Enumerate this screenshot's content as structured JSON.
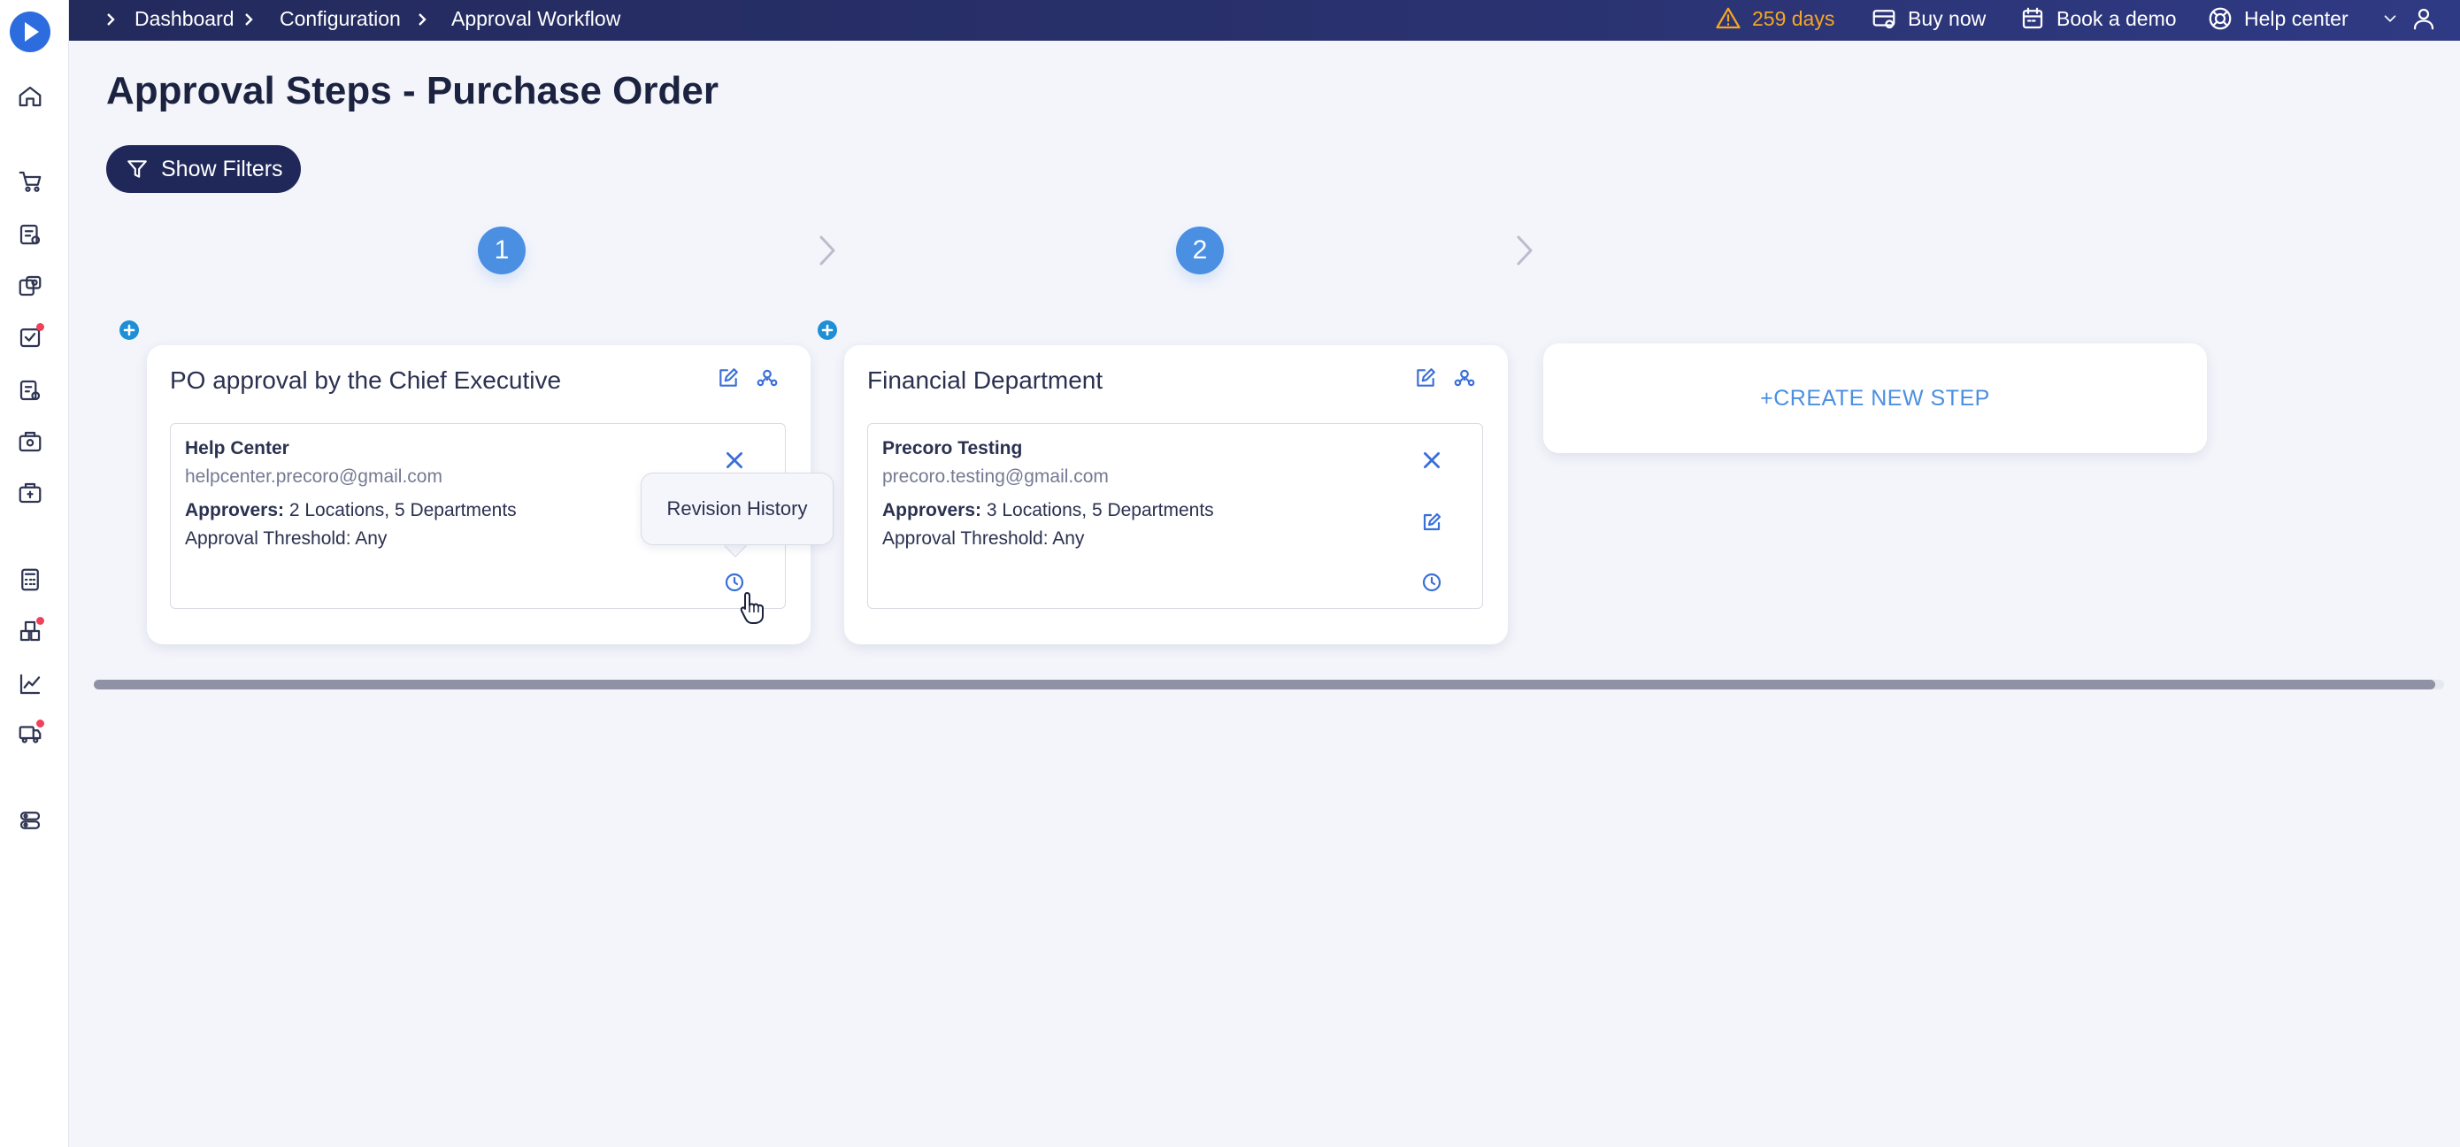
{
  "topbar": {
    "breadcrumbs": [
      "Dashboard",
      "Configuration",
      "Approval Workflow"
    ],
    "trial": "259 days",
    "buy_now": "Buy now",
    "book_demo": "Book a demo",
    "help_center": "Help center"
  },
  "page": {
    "title": "Approval Steps - Purchase Order",
    "filters_label": "Show Filters"
  },
  "steps": [
    {
      "number": "1",
      "title": "PO approval by the Chief Executive",
      "approver": {
        "name": "Help Center",
        "email": "helpcenter.precoro@gmail.com",
        "approvers_label": "Approvers:",
        "approvers_value": " 2 Locations, 5 Departments",
        "threshold": "Approval Threshold: Any"
      }
    },
    {
      "number": "2",
      "title": "Financial Department",
      "approver": {
        "name": "Precoro Testing",
        "email": "precoro.testing@gmail.com",
        "approvers_label": "Approvers:",
        "approvers_value": " 3 Locations, 5 Departments",
        "threshold": "Approval Threshold: Any"
      }
    }
  ],
  "create_step": "+CREATE NEW STEP",
  "tooltip": "Revision History",
  "colors": {
    "topbar": "#232a5c",
    "accent": "#4a8fe2",
    "warning": "#f5a623",
    "icon": "#3a6fd8"
  }
}
